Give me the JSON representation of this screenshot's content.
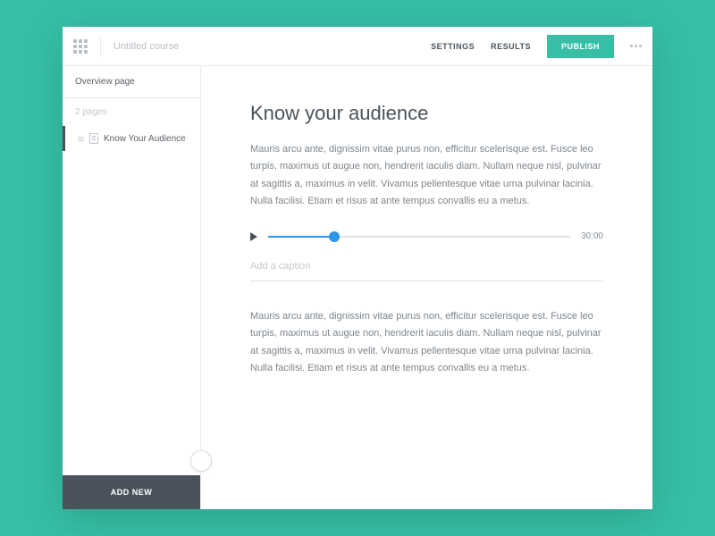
{
  "topbar": {
    "course_title": "Untitled course",
    "settings_label": "SETTINGS",
    "results_label": "RESULTS",
    "publish_label": "PUBLISH"
  },
  "sidebar": {
    "overview_label": "Overview page",
    "pages_count_label": "2 pages",
    "items": [
      {
        "label": "Know Your Audience"
      }
    ],
    "add_new_label": "ADD NEW"
  },
  "content": {
    "heading": "Know your audience",
    "paragraph1": "Mauris arcu ante, dignissim vitae purus non, efficitur scelerisque est. Fusce leo turpis, maximus ut augue non, hendrerit iaculis diam. Nullam neque nisl, pulvinar at sagittis a, maximus in velit. Vivamus pellentesque vitae urna pulvinar lacinia. Nulla facilisi. Etiam et risus at ante tempus convallis eu a metus.",
    "audio": {
      "duration": "30:00",
      "caption_placeholder": "Add a caption"
    },
    "paragraph2": "Mauris arcu ante, dignissim vitae purus non, efficitur scelerisque est. Fusce leo turpis, maximus ut augue non, hendrerit iaculis diam. Nullam neque nisl, pulvinar at sagittis a, maximus in velit. Vivamus pellentesque vitae urna pulvinar lacinia. Nulla facilisi. Etiam et risus at ante tempus convallis eu a metus."
  },
  "colors": {
    "accent": "#36bfa5",
    "audio_accent": "#2b95e8"
  }
}
